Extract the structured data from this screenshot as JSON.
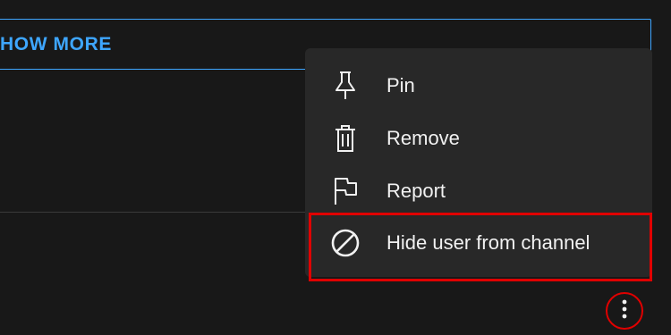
{
  "show_more": {
    "label": "HOW MORE"
  },
  "menu": {
    "items": [
      {
        "label": "Pin",
        "icon": "pin-icon"
      },
      {
        "label": "Remove",
        "icon": "trash-icon"
      },
      {
        "label": "Report",
        "icon": "flag-icon"
      },
      {
        "label": "Hide user from channel",
        "icon": "block-icon"
      }
    ]
  },
  "more_button": {
    "icon": "more-vertical-icon"
  },
  "colors": {
    "background": "#181818",
    "menu_background": "#282828",
    "accent_blue": "#3ea6ff",
    "highlight_red": "#e00000",
    "text": "#f1f1f1"
  }
}
